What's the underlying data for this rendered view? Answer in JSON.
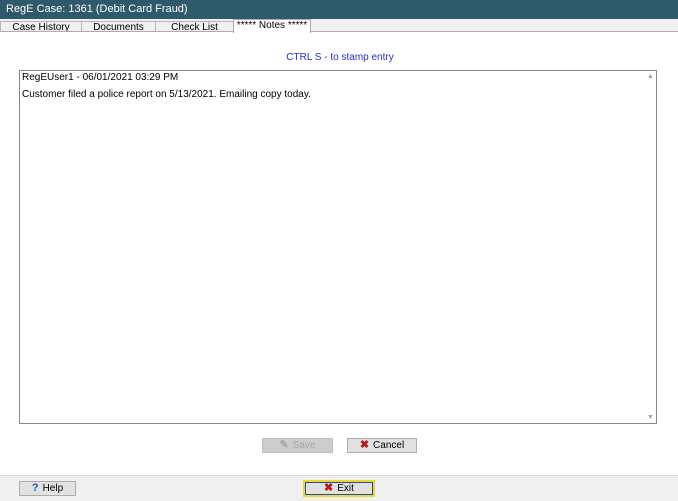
{
  "window": {
    "title": "RegE Case: 1361 (Debit Card Fraud)"
  },
  "tabs": [
    {
      "label": "Case History"
    },
    {
      "label": "Documents"
    },
    {
      "label": "Check List"
    },
    {
      "label": "***** Notes *****"
    }
  ],
  "notes": {
    "hint": "CTRL S - to stamp entry",
    "entry_header": "RegEUser1  - 06/01/2021 03:29 PM",
    "entry_body": "Customer filed a police report on 5/13/2021.  Emailing copy today."
  },
  "buttons": {
    "save_label": "Save",
    "cancel_label": "Cancel",
    "help_label": "Help",
    "exit_label": "Exit"
  },
  "icons": {
    "save": "pencil-icon",
    "cancel": "x-icon",
    "help": "question-icon",
    "exit": "x-icon"
  }
}
